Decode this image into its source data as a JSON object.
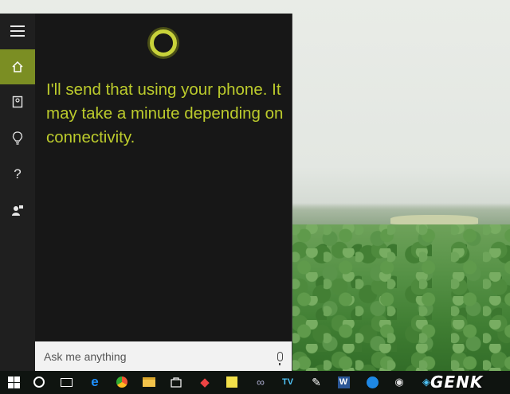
{
  "cortana": {
    "response_text": "I'll send that using your phone. It may take a minute depending on connectivity.",
    "accent_color": "#7b8e23",
    "text_color": "#bccb2c"
  },
  "nav": {
    "items": [
      {
        "name": "menu-icon",
        "glyph": ""
      },
      {
        "name": "home-icon",
        "glyph": "⌂"
      },
      {
        "name": "notebook-icon",
        "glyph": "▢"
      },
      {
        "name": "lightbulb-icon",
        "glyph": "♀"
      },
      {
        "name": "help-icon",
        "glyph": "?"
      },
      {
        "name": "feedback-icon",
        "glyph": "☗"
      }
    ]
  },
  "search": {
    "placeholder": "Ask me anything"
  },
  "taskbar": {
    "icons": [
      "start-icon",
      "cortana-icon",
      "task-view-icon",
      "edge-icon",
      "app-icon",
      "file-explorer-icon",
      "store-icon",
      "app-icon",
      "sticky-notes-icon",
      "app-icon",
      "app-icon",
      "app-icon",
      "word-icon",
      "messenger-icon",
      "app-icon",
      "app-icon"
    ],
    "watermark": "GENK"
  }
}
